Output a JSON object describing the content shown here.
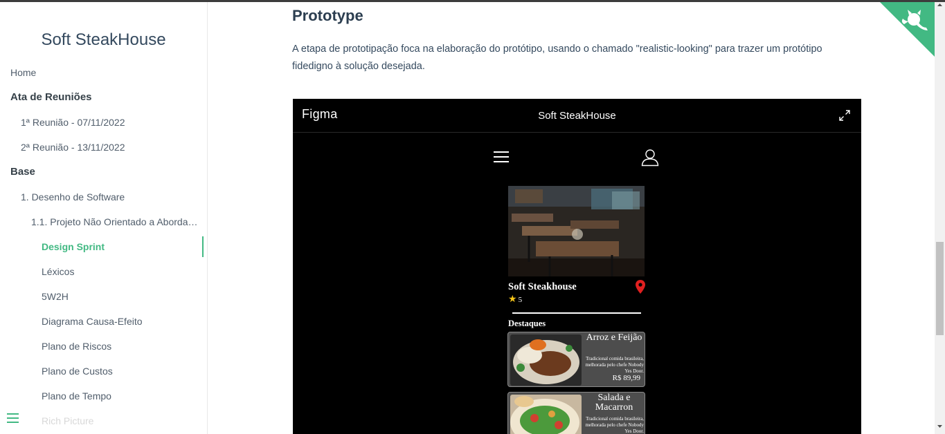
{
  "sidebar": {
    "app_name": "Soft SteakHouse",
    "items": [
      {
        "label": "Home"
      },
      {
        "label": "Ata de Reuniões"
      },
      {
        "label": "1ª Reunião - 07/11/2022"
      },
      {
        "label": "2ª Reunião - 13/11/2022"
      },
      {
        "label": "Base"
      },
      {
        "label": "1. Desenho de Software"
      },
      {
        "label": "1.1. Projeto Não Orientado a Abordagens..."
      },
      {
        "label": "Design Sprint"
      },
      {
        "label": "Léxicos"
      },
      {
        "label": "5W2H"
      },
      {
        "label": "Diagrama Causa-Efeito"
      },
      {
        "label": "Plano de Riscos"
      },
      {
        "label": "Plano de Custos"
      },
      {
        "label": "Plano de Tempo"
      },
      {
        "label": "Rich Picture"
      }
    ]
  },
  "content": {
    "heading": "Prototype",
    "paragraph": "A etapa de prototipação foca na elaboração do protótipo, usando o chamado \"realistic-looking\" para trazer um protótipo fidedigno à solução desejada.",
    "embed": {
      "brand": "Figma",
      "title": "Soft SteakHouse",
      "prototype": {
        "restaurant_name": "Soft Steakhouse",
        "rating": "5",
        "section_title": "Destaques",
        "cards": [
          {
            "title": "Arroz e Feijão",
            "description": "Tradicional comida brasileira, melhorada pelo chefe Nobody Yes Door.",
            "price": "R$ 89,99"
          },
          {
            "title": "Salada e Macarron",
            "description": "Tradicional comida brasileira, melhorada pelo chefe Nobody Yes Door.",
            "price": ""
          }
        ]
      }
    }
  },
  "colors": {
    "accent": "#42b983",
    "text": "#34495e",
    "embed_bg": "#000000",
    "card_bg": "#4d4d4d",
    "pin": "#e02020",
    "star": "#f5c518"
  },
  "icons": [
    "menu-icon",
    "github-corner-icon",
    "expand-icon",
    "hamburger-icon",
    "user-icon",
    "location-pin-icon",
    "star-icon"
  ]
}
